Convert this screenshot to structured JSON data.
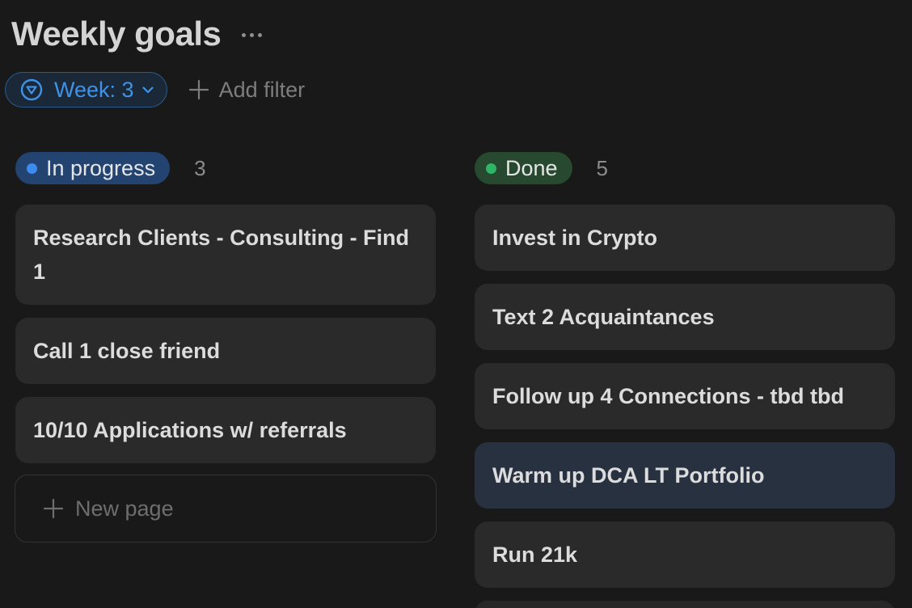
{
  "header": {
    "title": "Weekly goals",
    "more_icon": "more-horizontal-icon"
  },
  "filters": {
    "week_filter_label": "Week: 3",
    "add_filter_label": "Add filter"
  },
  "colors": {
    "background": "#191919",
    "card": "#2a2a2a",
    "card_selected": "#27313f",
    "accent_blue": "#3f93e6",
    "in_progress_pill": "#234470",
    "done_pill": "#27492f"
  },
  "columns": [
    {
      "status": "In progress",
      "count": "3",
      "cards": [
        "Research Clients - Consulting - Find 1",
        "Call 1 close friend",
        "10/10 Applications w/ referrals"
      ],
      "new_page_label": "New page"
    },
    {
      "status": "Done",
      "count": "5",
      "cards": [
        "Invest in Crypto",
        "Text 2 Acquaintances",
        "Follow up 4 Connections - tbd tbd",
        "Warm up DCA LT Portfolio",
        "Run 21k"
      ]
    }
  ]
}
